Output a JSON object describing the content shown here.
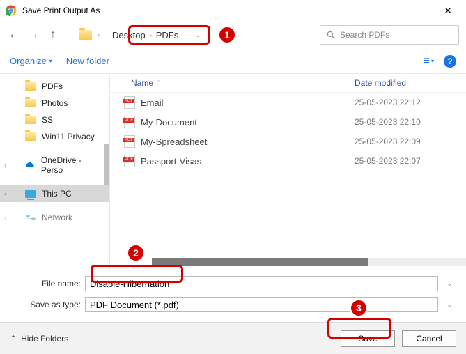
{
  "title": "Save Print Output As",
  "breadcrumb": {
    "parent": "Desktop",
    "current": "PDFs"
  },
  "search": {
    "placeholder": "Search PDFs"
  },
  "toolbar": {
    "organize": "Organize",
    "newfolder": "New folder"
  },
  "sidebar": {
    "items": [
      {
        "label": "PDFs"
      },
      {
        "label": "Photos"
      },
      {
        "label": "SS"
      },
      {
        "label": "Win11 Privacy"
      },
      {
        "label": "OneDrive - Perso"
      },
      {
        "label": "This PC"
      },
      {
        "label": "Network"
      }
    ]
  },
  "columns": {
    "name": "Name",
    "date": "Date modified"
  },
  "files": [
    {
      "name": "Email",
      "date": "25-05-2023 22:12"
    },
    {
      "name": "My-Document",
      "date": "25-05-2023 22:10"
    },
    {
      "name": "My-Spreadsheet",
      "date": "25-05-2023 22:09"
    },
    {
      "name": "Passport-Visas",
      "date": "25-05-2023 22:07"
    }
  ],
  "form": {
    "filename_label": "File name:",
    "filename_value": "Disable-Hibernation",
    "saveas_label": "Save as type:",
    "saveas_value": "PDF Document (*.pdf)"
  },
  "bottom": {
    "hide": "Hide Folders",
    "save": "Save",
    "cancel": "Cancel"
  },
  "annotations": {
    "n1": "1",
    "n2": "2",
    "n3": "3"
  }
}
